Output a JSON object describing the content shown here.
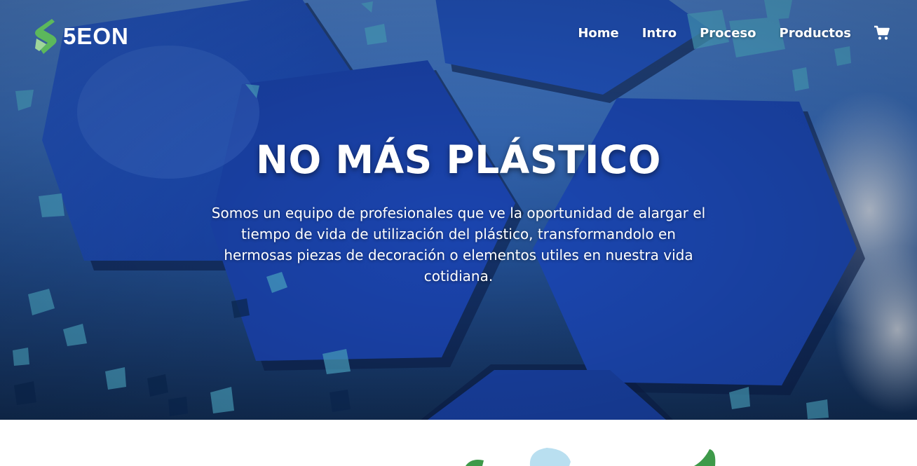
{
  "brand": {
    "name": "5EON",
    "accent": "#5cb85c",
    "accent_light": "#9fd69a"
  },
  "nav": {
    "items": [
      {
        "label": "Home"
      },
      {
        "label": "Intro"
      },
      {
        "label": "Proceso"
      },
      {
        "label": "Productos"
      }
    ],
    "cart_icon": "shopping-cart-icon"
  },
  "hero": {
    "title": "NO MÁS PLÁSTICO",
    "text": "Somos un equipo de profesionales que ve la oportunidad de alargar el tiempo de vida de utilización del plástico, transformandolo en hermosas piezas de decoración o elementos utiles en nuestra vida cotidiana.",
    "colors": {
      "tile": "#1e4fc4",
      "tile_edge": "#0d2a73",
      "sky": "#4f86d4"
    }
  },
  "below": {
    "decor_colors": {
      "leaf": "#3e9a4a",
      "petal": "#b9dff0"
    }
  }
}
